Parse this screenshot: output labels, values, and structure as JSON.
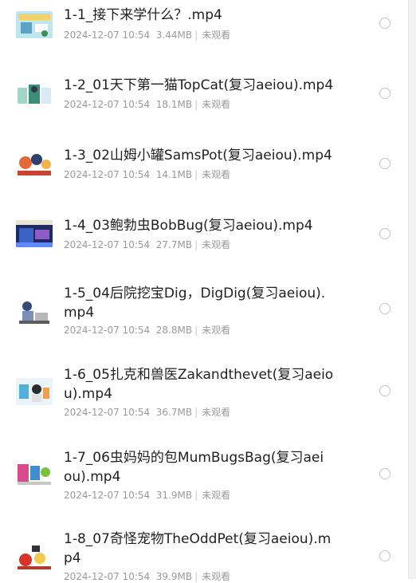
{
  "files": [
    {
      "title": "1-1_接下来学什么？.mp4",
      "date": "2024-12-07 10:54",
      "size": "3.44MB",
      "status": "未观看",
      "thumb_icon": "video-thumbnail-icon"
    },
    {
      "title": "1-2_01天下第一猫TopCat(复习aeiou).mp4",
      "date": "2024-12-07 10:54",
      "size": "18.1MB",
      "status": "未观看",
      "thumb_icon": "video-thumbnail-icon"
    },
    {
      "title": "1-3_02山姆小罐SamsPot(复习aeiou).mp4",
      "date": "2024-12-07 10:54",
      "size": "14.1MB",
      "status": "未观看",
      "thumb_icon": "video-thumbnail-icon"
    },
    {
      "title": "1-4_03鲍勃虫BobBug(复习aeiou).mp4",
      "date": "2024-12-07 10:54",
      "size": "27.7MB",
      "status": "未观看",
      "thumb_icon": "video-thumbnail-icon"
    },
    {
      "title": "1-5_04后院挖宝Dig，DigDig(复习aeiou).\nmp4",
      "date": "2024-12-07 10:54",
      "size": "28.8MB",
      "status": "未观看",
      "thumb_icon": "video-thumbnail-icon"
    },
    {
      "title": "1-6_05扎克和兽医Zakandthevet(复习aeio\nu).mp4",
      "date": "2024-12-07 10:54",
      "size": "36.7MB",
      "status": "未观看",
      "thumb_icon": "video-thumbnail-icon"
    },
    {
      "title": "1-7_06虫妈妈的包MumBugsBag(复习aei\nou).mp4",
      "date": "2024-12-07 10:54",
      "size": "31.9MB",
      "status": "未观看",
      "thumb_icon": "video-thumbnail-icon"
    },
    {
      "title": "1-8_07奇怪宠物TheOddPet(复习aeiou).m\np4",
      "date": "2024-12-07 10:54",
      "size": "39.9MB",
      "status": "未观看",
      "thumb_icon": "video-thumbnail-icon"
    }
  ]
}
